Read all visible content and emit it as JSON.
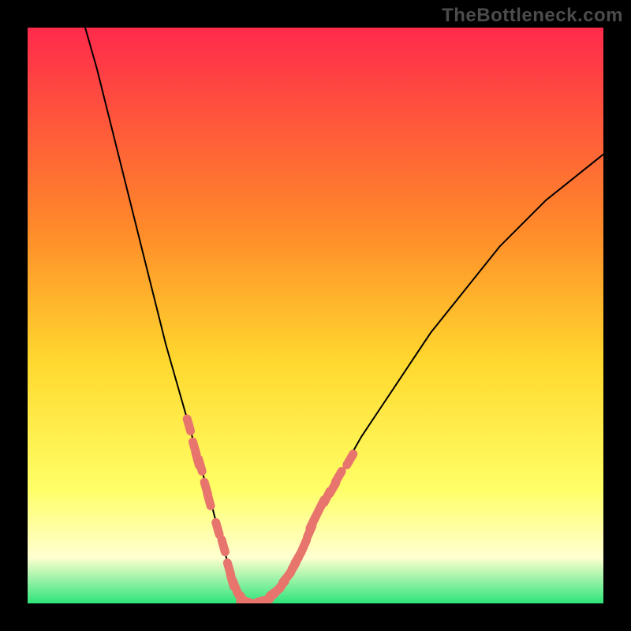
{
  "watermark": "TheBottleneck.com",
  "colors": {
    "gradient_top": "#ff2a4b",
    "gradient_mid_upper": "#ff8a2a",
    "gradient_mid": "#ffd82e",
    "gradient_mid_lower": "#ffff66",
    "gradient_pale": "#ffffd0",
    "gradient_green": "#2ee57a",
    "curve": "#000000",
    "markers": "#e8756d",
    "frame": "#000000"
  },
  "chart_data": {
    "type": "line",
    "title": "",
    "xlabel": "",
    "ylabel": "",
    "xlim": [
      0,
      100
    ],
    "ylim": [
      0,
      100
    ],
    "series": [
      {
        "name": "bottleneck-curve",
        "x": [
          10,
          12,
          14,
          16,
          18,
          20,
          22,
          24,
          26,
          28,
          30,
          32,
          33,
          34,
          35,
          36,
          37,
          38,
          40,
          42,
          44,
          46,
          48,
          50,
          54,
          58,
          62,
          66,
          70,
          74,
          78,
          82,
          86,
          90,
          95,
          100
        ],
        "y": [
          100,
          93,
          85,
          77,
          69,
          61,
          53,
          45,
          38,
          31,
          24,
          17,
          13,
          10,
          6,
          3,
          1,
          0,
          0,
          1,
          3,
          6,
          10,
          15,
          22,
          29,
          35,
          41,
          47,
          52,
          57,
          62,
          66,
          70,
          74,
          78
        ]
      }
    ],
    "markers": [
      {
        "x": 28,
        "y": 31
      },
      {
        "x": 29,
        "y": 27
      },
      {
        "x": 29.5,
        "y": 25
      },
      {
        "x": 30,
        "y": 24
      },
      {
        "x": 31,
        "y": 20
      },
      {
        "x": 31.5,
        "y": 18
      },
      {
        "x": 33,
        "y": 13
      },
      {
        "x": 34,
        "y": 10
      },
      {
        "x": 35,
        "y": 6
      },
      {
        "x": 35.5,
        "y": 4
      },
      {
        "x": 36,
        "y": 3
      },
      {
        "x": 37,
        "y": 1
      },
      {
        "x": 37.5,
        "y": 0.5
      },
      {
        "x": 38,
        "y": 0
      },
      {
        "x": 39,
        "y": 0
      },
      {
        "x": 40,
        "y": 0
      },
      {
        "x": 41,
        "y": 0.5
      },
      {
        "x": 42,
        "y": 1
      },
      {
        "x": 43,
        "y": 2
      },
      {
        "x": 44,
        "y": 3
      },
      {
        "x": 45,
        "y": 4.5
      },
      {
        "x": 46,
        "y": 6
      },
      {
        "x": 46.5,
        "y": 7
      },
      {
        "x": 47,
        "y": 8
      },
      {
        "x": 48,
        "y": 10
      },
      {
        "x": 49,
        "y": 12.5
      },
      {
        "x": 49.5,
        "y": 14
      },
      {
        "x": 50,
        "y": 15
      },
      {
        "x": 51,
        "y": 17
      },
      {
        "x": 52,
        "y": 18.5
      },
      {
        "x": 53,
        "y": 20
      },
      {
        "x": 54,
        "y": 22
      },
      {
        "x": 56,
        "y": 25
      }
    ]
  }
}
